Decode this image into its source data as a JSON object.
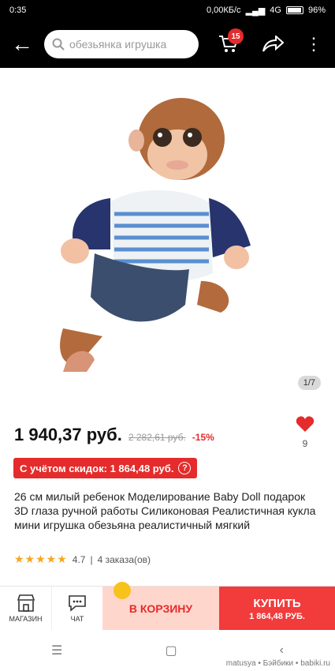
{
  "status": {
    "time": "0:35",
    "network_speed": "0,00КБ/с",
    "network": "4G",
    "battery": "96%",
    "battery_level": 0.96
  },
  "header": {
    "search_placeholder": "обезьянка игрушка",
    "cart_count": "15"
  },
  "image": {
    "counter": "1/7"
  },
  "product": {
    "price": "1 940,37 руб.",
    "old_price": "2 282,61 руб.",
    "discount": "-15%",
    "favorites_count": "9",
    "coupon_text": "С учётом скидок: 1 864,48 руб.",
    "title": "26 см милый ребенок Моделирование Baby Doll подарок 3D глаза ручной работы Силиконовая Реалистичная кукла мини игрушка обезьяна реалистичный мягкий",
    "rating": "4.7",
    "orders": "4 заказа(ов)"
  },
  "bottom": {
    "store_label": "МАГАЗИН",
    "chat_label": "ЧАТ",
    "add_to_cart_label": "В КОРЗИНУ",
    "buy_label": "КУПИТЬ",
    "buy_price": "1 864,48 РУБ."
  },
  "watermark": "matusya • Бэйбики • babiki.ru",
  "colors": {
    "accent": "#f23b3b",
    "header_bg": "#000000",
    "star": "#f6a623"
  }
}
